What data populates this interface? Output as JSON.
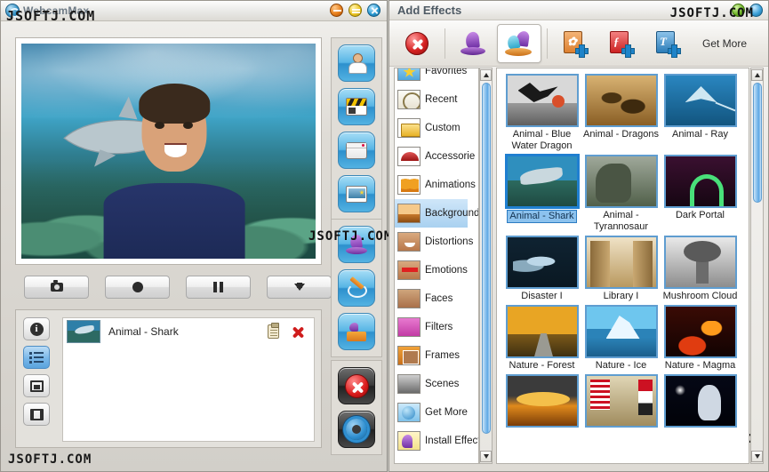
{
  "watermark": {
    "text": "JSOFTJ.COM"
  },
  "main_window": {
    "title": "WebcamMax",
    "app_icon": "webcam-icon",
    "window_buttons": [
      {
        "name": "minimize-button",
        "color": "#e8801c"
      },
      {
        "name": "maximize-button",
        "color": "#f0c827"
      },
      {
        "name": "close-button",
        "color": "#2a9bd4"
      }
    ],
    "preview": {
      "name": "video-preview",
      "description": "Man with shark underwater background effect"
    },
    "transport_buttons": [
      {
        "name": "snapshot-button",
        "icon": "camera-icon"
      },
      {
        "name": "record-button",
        "icon": "record-circle-icon"
      },
      {
        "name": "pause-button",
        "icon": "pause-icon"
      },
      {
        "name": "download-button",
        "icon": "arrow-down-icon"
      }
    ],
    "side_tabs": [
      {
        "name": "info-tab",
        "icon": "info-icon",
        "active": false
      },
      {
        "name": "effect-list-tab",
        "icon": "list-icon",
        "active": true
      },
      {
        "name": "picture-tab",
        "icon": "picture-icon",
        "active": false
      },
      {
        "name": "video-tab",
        "icon": "film-icon",
        "active": false
      }
    ],
    "applied_effects": [
      {
        "name": "Animal - Shark",
        "thumb": "shark-thumb",
        "settings_icon": "clipboard-icon",
        "remove_icon": "delete-x-icon"
      }
    ],
    "vertical_toolbar_groups": [
      {
        "group": "sources",
        "buttons": [
          {
            "name": "webcam-source-button",
            "icon": "person-icon"
          },
          {
            "name": "video-source-button",
            "icon": "clapperboard-icon"
          },
          {
            "name": "desktop-source-button",
            "icon": "window-icon"
          },
          {
            "name": "picture-source-button",
            "icon": "slideshow-icon"
          }
        ]
      },
      {
        "group": "effects",
        "buttons": [
          {
            "name": "add-effects-button",
            "icon": "magic-hat-icon"
          },
          {
            "name": "doodle-button",
            "icon": "pencil-icon"
          },
          {
            "name": "my-effects-button",
            "icon": "box-icon"
          }
        ]
      },
      {
        "group": "system",
        "buttons": [
          {
            "name": "clear-effects-button",
            "icon": "stop-x-icon"
          },
          {
            "name": "settings-button",
            "icon": "gear-icon"
          }
        ]
      }
    ]
  },
  "effects_panel": {
    "title": "Add Effects",
    "window_buttons": [
      {
        "name": "fx-minimize-button",
        "color": "#6db324"
      },
      {
        "name": "fx-close-button",
        "color": "#3aa0d8"
      }
    ],
    "toolbar": {
      "items": [
        {
          "name": "clear-effects-button",
          "icon": "red-x-icon",
          "selected": false
        },
        {
          "name": "single-effect-button",
          "icon": "purple-hat-icon",
          "selected": false
        },
        {
          "name": "multi-effect-button",
          "icon": "multi-hat-icon",
          "selected": true
        },
        {
          "name": "add-picture-button",
          "icon": "add-image-doc-icon",
          "selected": false
        },
        {
          "name": "add-flash-button",
          "icon": "add-flash-doc-icon",
          "selected": false
        },
        {
          "name": "add-text-button",
          "icon": "add-text-doc-icon",
          "selected": false
        }
      ],
      "get_more_label": "Get More"
    },
    "categories": [
      {
        "label": "Favorites",
        "icon": "star-icon",
        "selected": false
      },
      {
        "label": "Recent",
        "icon": "clock-icon",
        "selected": false
      },
      {
        "label": "Custom",
        "icon": "folder-icon",
        "selected": false
      },
      {
        "label": "Accessorie",
        "icon": "cap-icon",
        "selected": false
      },
      {
        "label": "Animations",
        "icon": "butterfly-icon",
        "selected": false
      },
      {
        "label": "Background",
        "icon": "landscape-icon",
        "selected": true
      },
      {
        "label": "Distortions",
        "icon": "distorted-face-icon",
        "selected": false
      },
      {
        "label": "Emotions",
        "icon": "heart-eyes-face-icon",
        "selected": false
      },
      {
        "label": "Faces",
        "icon": "face-icon",
        "selected": false
      },
      {
        "label": "Filters",
        "icon": "pink-filter-face-icon",
        "selected": false
      },
      {
        "label": "Frames",
        "icon": "frame-icon",
        "selected": false
      },
      {
        "label": "Scenes",
        "icon": "scene-icon",
        "selected": false
      },
      {
        "label": "Get More",
        "icon": "globe-arrow-icon",
        "selected": false
      },
      {
        "label": "Install Effects",
        "icon": "hat-plus-icon",
        "selected": false
      }
    ],
    "effects": [
      {
        "label": "Animal - Blue Water Dragon",
        "art": "t-bwd",
        "selected": false
      },
      {
        "label": "Animal - Dragons",
        "art": "t-drg",
        "selected": false
      },
      {
        "label": "Animal - Ray",
        "art": "t-ray",
        "selected": false
      },
      {
        "label": "Animal - Shark",
        "art": "t-shk",
        "selected": true
      },
      {
        "label": "Animal - Tyrannosaur",
        "art": "t-tyr",
        "selected": false
      },
      {
        "label": "Dark Portal",
        "art": "t-dpl",
        "selected": false
      },
      {
        "label": "Disaster I",
        "art": "t-dis",
        "selected": false
      },
      {
        "label": "Library I",
        "art": "t-lib",
        "selected": false
      },
      {
        "label": "Mushroom Cloud",
        "art": "t-msh",
        "selected": false
      },
      {
        "label": "Nature - Forest",
        "art": "t-for",
        "selected": false
      },
      {
        "label": "Nature - Ice",
        "art": "t-ice",
        "selected": false
      },
      {
        "label": "Nature - Magma",
        "art": "t-mag",
        "selected": false
      },
      {
        "label": "",
        "art": "t-nuk",
        "selected": false
      },
      {
        "label": "",
        "art": "t-usa",
        "selected": false
      },
      {
        "label": "",
        "art": "t-ast",
        "selected": false
      }
    ]
  }
}
